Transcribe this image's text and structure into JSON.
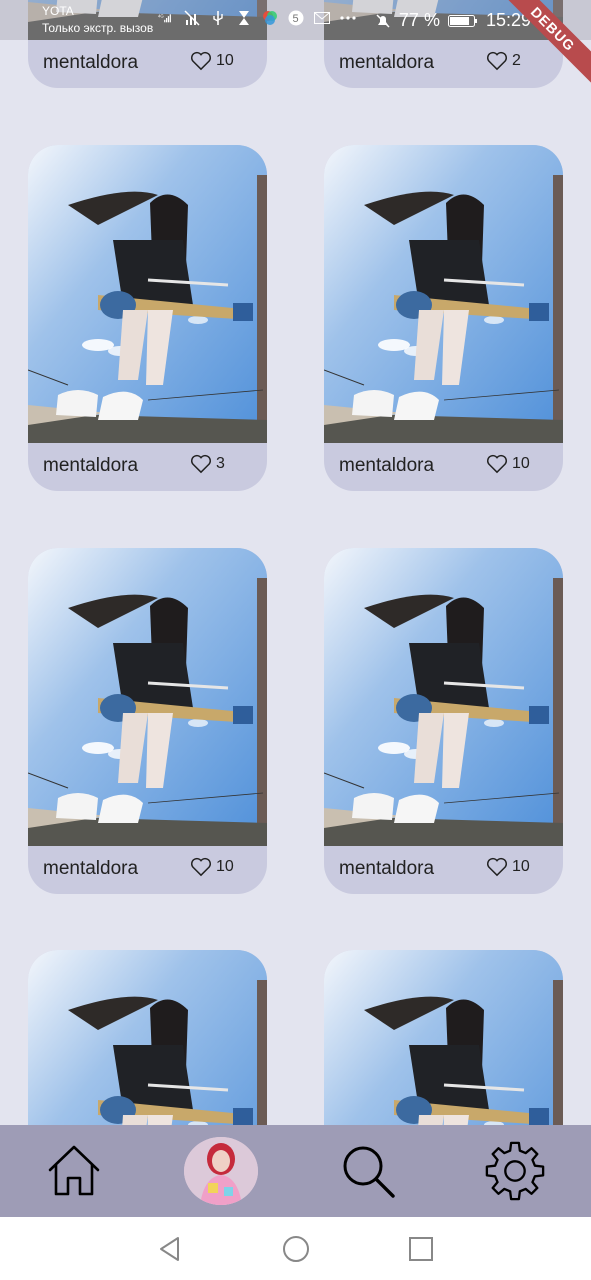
{
  "status_bar": {
    "carrier": "YOTA",
    "carrier_sub": "Только экстр. вызов",
    "network": "4G",
    "battery_percent": "77 %",
    "time": "15:29"
  },
  "debug_label": "DEBUG",
  "posts": [
    {
      "user": "mentaldora",
      "likes": "10"
    },
    {
      "user": "mentaldora",
      "likes": "2"
    },
    {
      "user": "mentaldora",
      "likes": "3"
    },
    {
      "user": "mentaldora",
      "likes": "10"
    },
    {
      "user": "mentaldora",
      "likes": "10"
    },
    {
      "user": "mentaldora",
      "likes": "10"
    },
    {
      "user": "",
      "likes": ""
    },
    {
      "user": "",
      "likes": ""
    }
  ],
  "bottom_nav": {
    "items": [
      {
        "icon": "home-icon"
      },
      {
        "icon": "profile-avatar"
      },
      {
        "icon": "search-icon"
      },
      {
        "icon": "settings-gear-icon"
      }
    ]
  },
  "system_nav": {
    "items": [
      {
        "icon": "back-triangle-icon"
      },
      {
        "icon": "home-circle-icon"
      },
      {
        "icon": "recents-square-icon"
      }
    ]
  },
  "colors": {
    "background": "#e3e4ef",
    "card": "#c9cadf",
    "bottom_nav": "#9e9cb6",
    "debug_ribbon": "#b84b4d"
  }
}
